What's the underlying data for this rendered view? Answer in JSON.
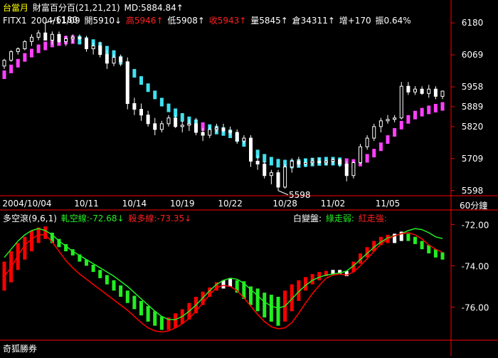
{
  "colors": {
    "bg": "#000000",
    "axis": "#ff0000",
    "text": "#ffffff",
    "yellow": "#ffff00",
    "red": "#ff0000",
    "magenta": "#ff40ff",
    "cyan": "#40e0f0",
    "green": "#22ee22",
    "up_candle": "#ffffff",
    "down_candle": "#ffffff"
  },
  "header": {
    "product": "台當月",
    "indicator": "財富百分百(21,21,21)",
    "md": "MD:5884.84↑",
    "symbol": "FITX1",
    "date": "2004/11/09",
    "open": "開5910↓",
    "high": "高5946↑",
    "low": "低5908↑",
    "close": "收5943↑",
    "volume": "量5845↑",
    "oi": "倉34311↑",
    "change": "增+170",
    "amplitude": "振0.64%"
  },
  "sub_header": {
    "title": "多空滾(9,6,1)",
    "line1": "軋空線:-72.68↓",
    "line2": "殺多線:-73.35↓",
    "right_label": "白變盤:",
    "green_label": "綠走弱:",
    "red_label": "紅走強:"
  },
  "period_label": "60分鐘",
  "footer_label": "奇狐勝券",
  "chart_data": [
    {
      "type": "candlestick",
      "y_ticks": [
        6180,
        6069,
        5958,
        5889,
        5820,
        5709,
        5598
      ],
      "ylim": [
        5590,
        6200
      ],
      "x_tick_labels": [
        "2004/10/04",
        "10/11",
        "10/14",
        "10/19",
        "10/22",
        "10/28",
        "11/02",
        "11/05"
      ],
      "annotations": [
        {
          "label": "6180",
          "value": 6180
        },
        {
          "label": "5598",
          "value": 5598
        }
      ],
      "ohlc": [
        [
          6030,
          6055,
          6020,
          6050
        ],
        [
          6050,
          6085,
          6045,
          6080
        ],
        [
          6080,
          6095,
          6070,
          6090
        ],
        [
          6090,
          6120,
          6085,
          6115
        ],
        [
          6115,
          6140,
          6100,
          6130
        ],
        [
          6130,
          6155,
          6120,
          6145
        ],
        [
          6145,
          6180,
          6135,
          6120
        ],
        [
          6120,
          6150,
          6105,
          6140
        ],
        [
          6140,
          6150,
          6110,
          6115
        ],
        [
          6115,
          6135,
          6100,
          6125
        ],
        [
          6125,
          6140,
          6110,
          6130
        ],
        [
          6130,
          6140,
          6120,
          6125
        ],
        [
          6125,
          6135,
          6080,
          6090
        ],
        [
          6090,
          6110,
          6070,
          6100
        ],
        [
          6100,
          6115,
          6060,
          6070
        ],
        [
          6070,
          6085,
          6020,
          6040
        ],
        [
          6040,
          6070,
          6030,
          6060
        ],
        [
          6060,
          6070,
          6030,
          6045
        ],
        [
          6045,
          6060,
          5880,
          5900
        ],
        [
          5900,
          5920,
          5860,
          5880
        ],
        [
          5880,
          5900,
          5840,
          5860
        ],
        [
          5860,
          5875,
          5820,
          5830
        ],
        [
          5830,
          5850,
          5790,
          5810
        ],
        [
          5810,
          5840,
          5800,
          5830
        ],
        [
          5830,
          5860,
          5820,
          5850
        ],
        [
          5850,
          5860,
          5815,
          5820
        ],
        [
          5820,
          5840,
          5800,
          5825
        ],
        [
          5825,
          5845,
          5805,
          5830
        ],
        [
          5830,
          5850,
          5790,
          5800
        ],
        [
          5800,
          5815,
          5770,
          5790
        ],
        [
          5790,
          5820,
          5780,
          5810
        ],
        [
          5810,
          5830,
          5800,
          5815
        ],
        [
          5815,
          5830,
          5800,
          5805
        ],
        [
          5805,
          5820,
          5790,
          5800
        ],
        [
          5800,
          5810,
          5760,
          5770
        ],
        [
          5770,
          5790,
          5760,
          5780
        ],
        [
          5780,
          5790,
          5680,
          5700
        ],
        [
          5700,
          5720,
          5670,
          5690
        ],
        [
          5690,
          5700,
          5640,
          5650
        ],
        [
          5650,
          5670,
          5620,
          5660
        ],
        [
          5660,
          5670,
          5598,
          5610
        ],
        [
          5610,
          5690,
          5605,
          5680
        ],
        [
          5680,
          5710,
          5660,
          5700
        ],
        [
          5700,
          5715,
          5680,
          5690
        ],
        [
          5690,
          5705,
          5680,
          5695
        ],
        [
          5695,
          5710,
          5685,
          5700
        ],
        [
          5700,
          5710,
          5690,
          5695
        ],
        [
          5695,
          5705,
          5685,
          5700
        ],
        [
          5700,
          5710,
          5690,
          5705
        ],
        [
          5705,
          5710,
          5680,
          5690
        ],
        [
          5690,
          5700,
          5630,
          5650
        ],
        [
          5650,
          5700,
          5640,
          5695
        ],
        [
          5695,
          5760,
          5690,
          5750
        ],
        [
          5750,
          5790,
          5740,
          5780
        ],
        [
          5780,
          5830,
          5770,
          5820
        ],
        [
          5820,
          5850,
          5800,
          5840
        ],
        [
          5840,
          5860,
          5830,
          5845
        ],
        [
          5845,
          5860,
          5835,
          5850
        ],
        [
          5850,
          5975,
          5845,
          5960
        ],
        [
          5960,
          5975,
          5930,
          5940
        ],
        [
          5940,
          5960,
          5930,
          5950
        ],
        [
          5950,
          5960,
          5930,
          5935
        ],
        [
          5935,
          5965,
          5920,
          5950
        ],
        [
          5950,
          5960,
          5915,
          5925
        ],
        [
          5925,
          5945,
          5915,
          5943
        ]
      ],
      "band": [
        6000,
        6020,
        6040,
        6060,
        6075,
        6090,
        6100,
        6110,
        6115,
        6120,
        6122,
        6120,
        6115,
        6108,
        6098,
        6085,
        6070,
        6050,
        6030,
        6005,
        5980,
        5955,
        5930,
        5905,
        5885,
        5868,
        5852,
        5840,
        5830,
        5820,
        5813,
        5808,
        5803,
        5795,
        5782,
        5765,
        5745,
        5725,
        5710,
        5700,
        5693,
        5690,
        5690,
        5692,
        5695,
        5697,
        5699,
        5700,
        5700,
        5698,
        5695,
        5692,
        5697,
        5710,
        5728,
        5750,
        5775,
        5800,
        5825,
        5845,
        5860,
        5870,
        5878,
        5884,
        5890
      ],
      "band_color": [
        "magenta",
        "magenta",
        "magenta",
        "magenta",
        "magenta",
        "magenta",
        "magenta",
        "magenta",
        "magenta",
        "magenta",
        "magenta",
        "cyan",
        "cyan",
        "cyan",
        "cyan",
        "cyan",
        "cyan",
        "cyan",
        "cyan",
        "cyan",
        "cyan",
        "cyan",
        "cyan",
        "cyan",
        "cyan",
        "cyan",
        "cyan",
        "cyan",
        "cyan",
        "magenta",
        "cyan",
        "cyan",
        "cyan",
        "cyan",
        "cyan",
        "cyan",
        "cyan",
        "cyan",
        "cyan",
        "cyan",
        "cyan",
        "cyan",
        "cyan",
        "cyan",
        "cyan",
        "cyan",
        "cyan",
        "cyan",
        "cyan",
        "cyan",
        "magenta",
        "magenta",
        "magenta",
        "magenta",
        "magenta",
        "magenta",
        "magenta",
        "magenta",
        "magenta",
        "magenta",
        "magenta",
        "magenta",
        "magenta",
        "magenta",
        "magenta"
      ]
    },
    {
      "type": "bar+line",
      "y_ticks": [
        -72.0,
        -74.0,
        -76.0
      ],
      "y_tick_labels": [
        "-72.00",
        "-74.00",
        "-76.00"
      ],
      "ylim": [
        -77.6,
        -71.3
      ],
      "bars_top": [
        -73.8,
        -73.3,
        -72.9,
        -72.6,
        -72.3,
        -72.15,
        -72.1,
        -72.4,
        -72.7,
        -72.95,
        -73.2,
        -73.45,
        -73.7,
        -73.95,
        -74.2,
        -74.45,
        -74.7,
        -74.95,
        -75.2,
        -75.45,
        -75.7,
        -75.95,
        -76.2,
        -76.45,
        -76.5,
        -76.3,
        -76.1,
        -75.8,
        -75.5,
        -75.25,
        -75.05,
        -74.8,
        -74.7,
        -74.6,
        -74.7,
        -74.75,
        -75.0,
        -75.1,
        -75.3,
        -75.4,
        -75.5,
        -75.2,
        -74.9,
        -74.7,
        -74.55,
        -74.4,
        -74.3,
        -74.25,
        -74.2,
        -74.2,
        -74.25,
        -73.8,
        -73.4,
        -73.1,
        -72.8,
        -72.6,
        -72.5,
        -72.45,
        -72.35,
        -72.45,
        -72.6,
        -72.8,
        -73.0,
        -73.2,
        -73.35
      ],
      "bars_bottom": [
        -75.2,
        -74.8,
        -74.2,
        -73.7,
        -73.3,
        -72.9,
        -72.7,
        -72.9,
        -73.1,
        -73.3,
        -73.5,
        -73.8,
        -74.0,
        -74.3,
        -74.6,
        -74.9,
        -75.2,
        -75.5,
        -75.8,
        -76.1,
        -76.4,
        -76.7,
        -76.9,
        -77.1,
        -77.1,
        -77.0,
        -76.8,
        -76.6,
        -76.3,
        -75.9,
        -75.5,
        -75.2,
        -75.1,
        -75.0,
        -75.3,
        -75.6,
        -75.9,
        -76.2,
        -76.5,
        -76.7,
        -76.9,
        -76.7,
        -76.2,
        -75.7,
        -75.2,
        -74.9,
        -74.7,
        -74.5,
        -74.4,
        -74.4,
        -74.5,
        -74.3,
        -73.9,
        -73.6,
        -73.3,
        -73.0,
        -72.9,
        -72.9,
        -72.8,
        -72.8,
        -72.95,
        -73.2,
        -73.4,
        -73.6,
        -73.7
      ],
      "bar_color": [
        "red",
        "red",
        "red",
        "red",
        "red",
        "red",
        "red",
        "green",
        "green",
        "green",
        "green",
        "green",
        "green",
        "green",
        "green",
        "green",
        "green",
        "green",
        "green",
        "green",
        "green",
        "green",
        "green",
        "green",
        "red",
        "red",
        "red",
        "red",
        "red",
        "red",
        "red",
        "red",
        "white",
        "white",
        "green",
        "green",
        "green",
        "green",
        "green",
        "green",
        "green",
        "red",
        "red",
        "red",
        "red",
        "red",
        "red",
        "red",
        "white",
        "white",
        "white",
        "red",
        "red",
        "red",
        "red",
        "red",
        "red",
        "white",
        "white",
        "green",
        "green",
        "green",
        "green",
        "green",
        "green"
      ],
      "series": [
        {
          "name": "軋空線",
          "color": "green",
          "values": [
            -73.6,
            -73.2,
            -72.8,
            -72.5,
            -72.3,
            -72.2,
            -72.3,
            -72.5,
            -72.8,
            -73.05,
            -73.3,
            -73.5,
            -73.7,
            -73.9,
            -74.1,
            -74.3,
            -74.5,
            -74.75,
            -75.0,
            -75.3,
            -75.6,
            -75.9,
            -76.2,
            -76.45,
            -76.6,
            -76.6,
            -76.45,
            -76.2,
            -75.9,
            -75.55,
            -75.2,
            -74.9,
            -74.7,
            -74.6,
            -74.65,
            -74.85,
            -75.15,
            -75.45,
            -75.75,
            -75.95,
            -76.05,
            -75.95,
            -75.6,
            -75.25,
            -74.95,
            -74.7,
            -74.55,
            -74.45,
            -74.4,
            -74.35,
            -74.25,
            -74.0,
            -73.7,
            -73.4,
            -73.1,
            -72.85,
            -72.65,
            -72.55,
            -72.45,
            -72.3,
            -72.2,
            -72.25,
            -72.4,
            -72.6,
            -72.68
          ]
        },
        {
          "name": "殺多線",
          "color": "red",
          "values": [
            -74.5,
            -74.1,
            -73.5,
            -73.0,
            -72.7,
            -72.5,
            -72.5,
            -72.85,
            -73.3,
            -73.75,
            -74.1,
            -74.4,
            -74.65,
            -74.9,
            -75.15,
            -75.4,
            -75.65,
            -75.9,
            -76.15,
            -76.45,
            -76.75,
            -77.0,
            -77.15,
            -77.2,
            -77.15,
            -77.0,
            -76.8,
            -76.55,
            -76.2,
            -75.8,
            -75.4,
            -75.05,
            -74.95,
            -75.0,
            -75.2,
            -75.55,
            -75.95,
            -76.35,
            -76.7,
            -76.95,
            -77.05,
            -77.0,
            -76.75,
            -76.3,
            -75.8,
            -75.35,
            -74.95,
            -74.6,
            -74.45,
            -74.4,
            -74.45,
            -74.3,
            -74.0,
            -73.65,
            -73.3,
            -72.95,
            -72.7,
            -72.55,
            -72.45,
            -72.4,
            -72.5,
            -72.7,
            -73.0,
            -73.2,
            -73.35
          ]
        }
      ]
    }
  ]
}
